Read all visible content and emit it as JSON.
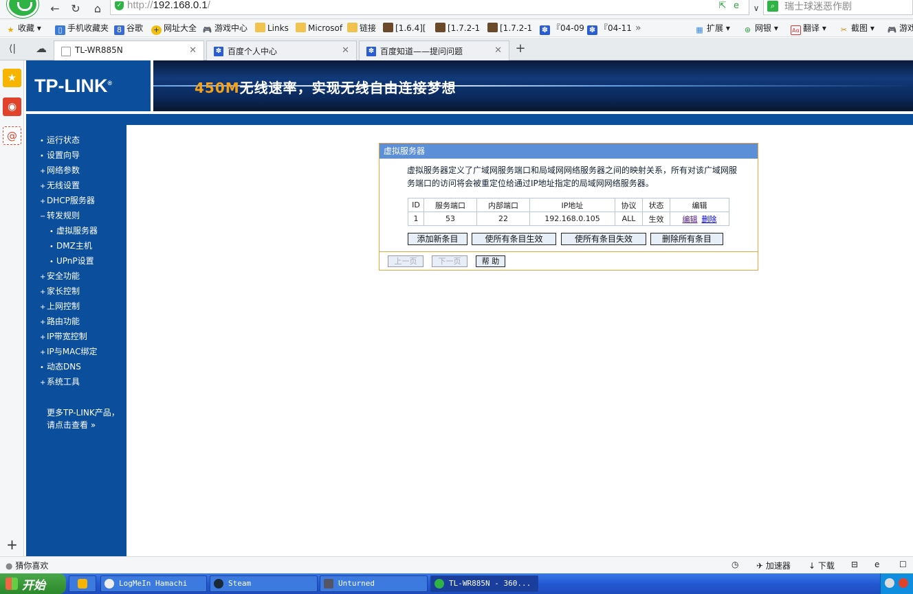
{
  "browser": {
    "url_host": "http://",
    "url_ip": "192.168.0.1",
    "url_tail": "/",
    "search_text": "瑞士球迷恶作剧",
    "bookmarks": [
      "收藏",
      "手机收藏夹",
      "谷歌",
      "网址大全",
      "游戏中心",
      "Links",
      "Microsof",
      "链接",
      "[1.6.4][",
      "[1.7.2-1",
      "[1.7.2-1",
      "『04-09",
      "『04-11"
    ],
    "bookmark_more": "»",
    "extras": [
      "扩展",
      "网银",
      "翻译",
      "截图",
      "游戏"
    ],
    "tabs": [
      {
        "label": "TL-WR885N"
      },
      {
        "label": "百度个人中心"
      },
      {
        "label": "百度知道——提问问题"
      }
    ],
    "new_tab": "+"
  },
  "router": {
    "logo": "TP-LINK",
    "logo_mark": "®",
    "slogan_hl": "450M",
    "slogan_rest": "无线速率，实现无线自由连接梦想",
    "menu": [
      {
        "label": "运行状态",
        "marker": "•"
      },
      {
        "label": "设置向导",
        "marker": "•"
      },
      {
        "label": "网络参数",
        "marker": "+"
      },
      {
        "label": "无线设置",
        "marker": "+"
      },
      {
        "label": "DHCP服务器",
        "marker": "+"
      },
      {
        "label": "转发规则",
        "marker": "−"
      },
      {
        "label": "虚拟服务器",
        "marker": "•"
      },
      {
        "label": "DMZ主机",
        "marker": "•"
      },
      {
        "label": "UPnP设置",
        "marker": "•"
      },
      {
        "label": "安全功能",
        "marker": "+"
      },
      {
        "label": "家长控制",
        "marker": "+"
      },
      {
        "label": "上网控制",
        "marker": "+"
      },
      {
        "label": "路由功能",
        "marker": "+"
      },
      {
        "label": "IP带宽控制",
        "marker": "+"
      },
      {
        "label": "IP与MAC绑定",
        "marker": "+"
      },
      {
        "label": "动态DNS",
        "marker": "•"
      },
      {
        "label": "系统工具",
        "marker": "+"
      }
    ],
    "more_line1": "更多TP-LINK产品，",
    "more_line2": "请点击查看 »",
    "panel": {
      "title": "虚拟服务器",
      "desc": "虚拟服务器定义了广域网服务端口和局域网网络服务器之间的映射关系，所有对该广域网服务端口的访问将会被重定位给通过IP地址指定的局域网网络服务器。",
      "headers": [
        "ID",
        "服务端口",
        "内部端口",
        "IP地址",
        "协议",
        "状态",
        "编辑"
      ],
      "rows": [
        {
          "id": "1",
          "svc_port": "53",
          "int_port": "22",
          "ip": "192.168.0.105",
          "proto": "ALL",
          "status": "生效",
          "edit": "编辑",
          "del": "删除"
        }
      ],
      "buttons": [
        "添加新条目",
        "使所有条目生效",
        "使所有条目失效",
        "删除所有条目"
      ],
      "nav_buttons": [
        "上一页",
        "下一页",
        "帮 助"
      ]
    }
  },
  "statusbar": {
    "left": "猜你喜欢",
    "accelerator": "加速器",
    "download": "下载"
  },
  "taskbar": {
    "start": "开始",
    "items": [
      "LogMeIn Hamachi",
      "Steam",
      "Unturned",
      "TL-WR885N - 360..."
    ]
  },
  "colors": {
    "router_blue": "#0a4e9c",
    "panel_title": "#5b8fd8",
    "panel_border": "#f2a43a",
    "slogan_orange": "#f4a21a"
  }
}
